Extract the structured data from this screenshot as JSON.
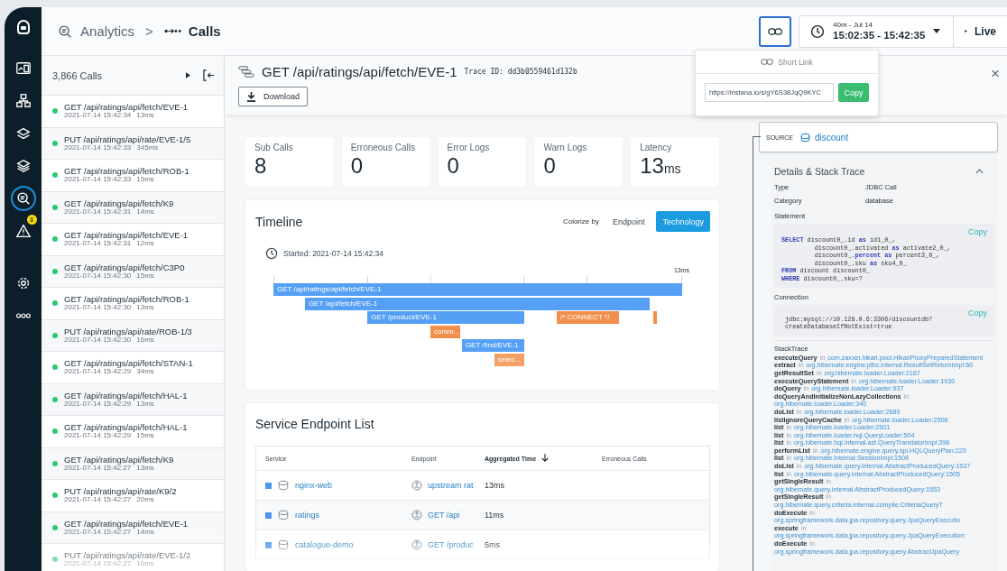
{
  "nav": [
    {
      "kind": "dashboard",
      "selected": false
    },
    {
      "kind": "infrastructure",
      "selected": false
    },
    {
      "kind": "platforms",
      "selected": false
    },
    {
      "kind": "stack",
      "selected": false
    },
    {
      "kind": "analytics",
      "selected": true
    },
    {
      "kind": "events",
      "selected": false,
      "badge": "3"
    },
    {
      "kind": "settings",
      "selected": false
    },
    {
      "kind": "more",
      "selected": false
    }
  ],
  "breadcrumb": {
    "parent": "Analytics",
    "separator": ">",
    "current": "Calls"
  },
  "header": {
    "link_button_active": true,
    "range_label": "40m - Jul 14",
    "range": "15:02:35 - 15:42:35",
    "live": "Live"
  },
  "short_link": {
    "title": "Short Link",
    "url": "https://instana.io/s/gY6S38JqQ9KYC",
    "copy": "Copy"
  },
  "calls_list": {
    "count": "3,866 Calls",
    "rows": [
      {
        "title": "GET /api/ratings/api/fetch/EVE-1",
        "time": "2021-07-14 15:42:34",
        "duration": "13ms"
      },
      {
        "title": "PUT /api/ratings/api/rate/EVE-1/5",
        "time": "2021-07-14 15:42:33",
        "duration": "345ms"
      },
      {
        "title": "GET /api/ratings/api/fetch/ROB-1",
        "time": "2021-07-14 15:42:33",
        "duration": "15ms"
      },
      {
        "title": "GET /api/ratings/api/fetch/K9",
        "time": "2021-07-14 15:42:31",
        "duration": "14ms"
      },
      {
        "title": "GET /api/ratings/api/fetch/EVE-1",
        "time": "2021-07-14 15:42:31",
        "duration": "12ms"
      },
      {
        "title": "GET /api/ratings/api/fetch/C3P0",
        "time": "2021-07-14 15:42:30",
        "duration": "15ms"
      },
      {
        "title": "GET /api/ratings/api/fetch/ROB-1",
        "time": "2021-07-14 15:42:30",
        "duration": "13ms"
      },
      {
        "title": "PUT /api/ratings/api/rate/ROB-1/3",
        "time": "2021-07-14 15:42:30",
        "duration": "16ms"
      },
      {
        "title": "GET /api/ratings/api/fetch/STAN-1",
        "time": "2021-07-14 15:42:29",
        "duration": "34ms"
      },
      {
        "title": "GET /api/ratings/api/fetch/HAL-1",
        "time": "2021-07-14 15:42:29",
        "duration": "13ms"
      },
      {
        "title": "GET /api/ratings/api/fetch/HAL-1",
        "time": "2021-07-14 15:42:29",
        "duration": "15ms"
      },
      {
        "title": "GET /api/ratings/api/fetch/K9",
        "time": "2021-07-14 15:42:27",
        "duration": "13ms"
      },
      {
        "title": "PUT /api/ratings/api/rate/K9/2",
        "time": "2021-07-14 15:42:27",
        "duration": "20ms"
      },
      {
        "title": "GET /api/ratings/api/fetch/EVE-1",
        "time": "2021-07-14 15:42:27",
        "duration": "14ms"
      },
      {
        "title": "PUT /api/ratings/api/rate/EVE-1/2",
        "time": "2021-07-14 15:42:27",
        "duration": "16ms"
      }
    ]
  },
  "call": {
    "title": "GET /api/ratings/api/fetch/EVE-1",
    "trace_id": "Trace ID: dd3b0559461d132b",
    "download": "Download",
    "close": "×"
  },
  "stats": [
    {
      "label": "Sub Calls",
      "value": "8"
    },
    {
      "label": "Erroneous Calls",
      "value": "0"
    },
    {
      "label": "Error Logs",
      "value": "0"
    },
    {
      "label": "Warn Logs",
      "value": "0"
    },
    {
      "label": "Latency",
      "value": "13",
      "unit": "ms"
    }
  ],
  "timeline": {
    "title": "Timeline",
    "colorize_label": "Colorize by",
    "colorize_options": [
      {
        "label": "Endpoint",
        "selected": false
      },
      {
        "label": "Technology",
        "selected": true
      }
    ],
    "started": "Started: 2021-07-14 15:42:34",
    "end_label": "13ms",
    "spans": [
      {
        "label": "GET /api/ratings/api/fetch/EVE-1",
        "kind": "http"
      },
      {
        "label": "GET /api/fetch/EVE-1",
        "kind": "http"
      },
      {
        "label": "GET /product/EVE-1",
        "kind": "http"
      },
      {
        "label": "/* CONNECT */",
        "kind": "database"
      },
      {
        "kind": "database"
      },
      {
        "label": "comm...",
        "kind": "database"
      },
      {
        "label": "GET /find/EVE-1",
        "kind": "http"
      },
      {
        "label": "selec...",
        "kind": "database"
      }
    ]
  },
  "endpoints": {
    "title": "Service Endpoint List",
    "columns": [
      "Service",
      "Endpoint",
      "Aggregated Time",
      "Erroneous Calls"
    ],
    "rows": [
      {
        "service": "nginx-web",
        "endpoint": "upstream rat",
        "time": "13ms"
      },
      {
        "service": "ratings",
        "endpoint": "GET /api",
        "time": "11ms"
      },
      {
        "service": "catalogue-demo",
        "endpoint": "GET /produc",
        "time": "5ms"
      }
    ]
  },
  "source": {
    "label": "SOURCE",
    "name": "discount"
  },
  "details": {
    "title": "Details & Stack Trace",
    "fields": [
      {
        "key": "Type",
        "value": "JDBC Call"
      },
      {
        "key": "Category",
        "value": "database"
      }
    ],
    "statement_label": "Statement",
    "statement_copy": "Copy",
    "statement": [
      "**SELECT** discount0_.id **as** id1_0_,",
      "         discount0_.activated **as** activate2_0_,",
      "         discount0_.**percent** **as** percent3_0_,",
      "         discount0_.sku **as** sku4_0_",
      "**FROM** discount discount0_",
      "**WHERE** discount0_.sku=?"
    ],
    "connection_label": "Connection",
    "connection_copy": "Copy",
    "connection": [
      "jdbc:mysql://10.128.0.6:3306/discountdb?",
      "createDatabaseIfNotExist=true"
    ],
    "stack_label": "StackTrace",
    "stack": [
      {
        "method": "executeQuery",
        "in": "in",
        "location": "com.zaxxer.hikari.pool.HikariProxyPreparedStatement"
      },
      {
        "method": "extract",
        "in": "in",
        "location": "org.hibernate.engine.jdbc.internal.ResultSetReturnImpl:60"
      },
      {
        "method": "getResultSet",
        "in": "in",
        "location": "org.hibernate.loader.Loader:2167"
      },
      {
        "method": "executeQueryStatement",
        "in": "in",
        "location": "org.hibernate.loader.Loader:1930"
      },
      {
        "method": "doQuery",
        "in": "in",
        "location": "org.hibernate.loader.Loader:937"
      },
      {
        "method": "doQueryAndInitializeNonLazyCollections",
        "in": "in",
        "location": "org.hibernate.loader.Loader:340"
      },
      {
        "method": "doList",
        "in": "in",
        "location": "org.hibernate.loader.Loader:2689"
      },
      {
        "method": "listIgnoreQueryCache",
        "in": "in",
        "location": "org.hibernate.loader.Loader:2506"
      },
      {
        "method": "list",
        "in": "in",
        "location": "org.hibernate.loader.Loader:2501"
      },
      {
        "method": "list",
        "in": "in",
        "location": "org.hibernate.loader.hql.QueryLoader:504"
      },
      {
        "method": "list",
        "in": "in",
        "location": "org.hibernate.hql.internal.ast.QueryTranslatorImpl:396"
      },
      {
        "method": "performList",
        "in": "in",
        "location": "org.hibernate.engine.query.spi.HQLQueryPlan:220"
      },
      {
        "method": "list",
        "in": "in",
        "location": "org.hibernate.internal.SessionImpl:1508"
      },
      {
        "method": "doList",
        "in": "in",
        "location": "org.hibernate.query.internal.AbstractProducedQuery:1537"
      },
      {
        "method": "list",
        "in": "in",
        "location": "org.hibernate.query.internal.AbstractProducedQuery:1505"
      },
      {
        "method": "getSingleResult",
        "in": "in",
        "location": "org.hibernate.query.internal.AbstractProducedQuery:1553"
      },
      {
        "method": "getSingleResult",
        "in": "in",
        "location": "org.hibernate.query.criteria.internal.compile.CriteriaQueryT"
      },
      {
        "method": "doExecute",
        "in": "in",
        "location": "org.springframework.data.jpa.repository.query.JpaQueryExecutio"
      },
      {
        "method": "execute",
        "in": "in",
        "location": "org.springframework.data.jpa.repository.query.JpaQueryExecution:"
      },
      {
        "method": "doExecute",
        "in": "in",
        "location": "org.springframework.data.jpa.repository.query.AbstractJpaQuery"
      }
    ]
  }
}
